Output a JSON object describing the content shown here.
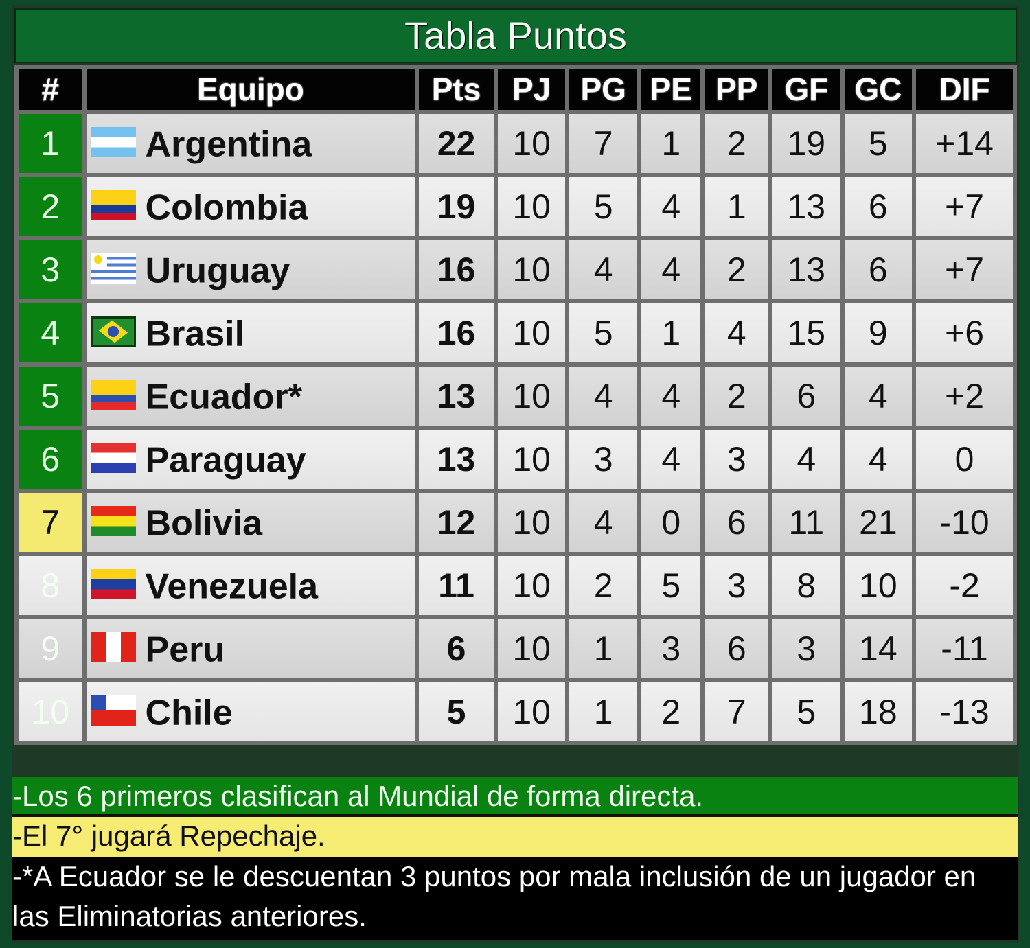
{
  "title": "Tabla Puntos",
  "columns": [
    "#",
    "Equipo",
    "Pts",
    "PJ",
    "PG",
    "PE",
    "PP",
    "GF",
    "GC",
    "DIF"
  ],
  "colors": {
    "direct_qualification": "#0a8212",
    "repechaje": "#f4ea72",
    "header_bg": "#030303",
    "title_bg": "#0b6a2c"
  },
  "rows": [
    {
      "pos": "1",
      "team": "Argentina",
      "flag": "argentina-flag",
      "status": "direct",
      "pts": "22",
      "pj": "10",
      "pg": "7",
      "pe": "1",
      "pp": "2",
      "gf": "19",
      "gc": "5",
      "dif": "+14"
    },
    {
      "pos": "2",
      "team": "Colombia",
      "flag": "colombia-flag",
      "status": "direct",
      "pts": "19",
      "pj": "10",
      "pg": "5",
      "pe": "4",
      "pp": "1",
      "gf": "13",
      "gc": "6",
      "dif": "+7"
    },
    {
      "pos": "3",
      "team": "Uruguay",
      "flag": "uruguay-flag",
      "status": "direct",
      "pts": "16",
      "pj": "10",
      "pg": "4",
      "pe": "4",
      "pp": "2",
      "gf": "13",
      "gc": "6",
      "dif": "+7"
    },
    {
      "pos": "4",
      "team": "Brasil",
      "flag": "brasil-flag",
      "status": "direct",
      "pts": "16",
      "pj": "10",
      "pg": "5",
      "pe": "1",
      "pp": "4",
      "gf": "15",
      "gc": "9",
      "dif": "+6"
    },
    {
      "pos": "5",
      "team": "Ecuador*",
      "flag": "ecuador-flag",
      "status": "direct",
      "pts": "13",
      "pj": "10",
      "pg": "4",
      "pe": "4",
      "pp": "2",
      "gf": "6",
      "gc": "4",
      "dif": "+2"
    },
    {
      "pos": "6",
      "team": "Paraguay",
      "flag": "paraguay-flag",
      "status": "direct",
      "pts": "13",
      "pj": "10",
      "pg": "3",
      "pe": "4",
      "pp": "3",
      "gf": "4",
      "gc": "4",
      "dif": "0"
    },
    {
      "pos": "7",
      "team": "Bolivia",
      "flag": "bolivia-flag",
      "status": "repechaje",
      "pts": "12",
      "pj": "10",
      "pg": "4",
      "pe": "0",
      "pp": "6",
      "gf": "11",
      "gc": "21",
      "dif": "-10"
    },
    {
      "pos": "8",
      "team": "Venezuela",
      "flag": "venezuela-flag",
      "status": "none",
      "pts": "11",
      "pj": "10",
      "pg": "2",
      "pe": "5",
      "pp": "3",
      "gf": "8",
      "gc": "10",
      "dif": "-2"
    },
    {
      "pos": "9",
      "team": "Peru",
      "flag": "peru-flag",
      "status": "none",
      "pts": "6",
      "pj": "10",
      "pg": "1",
      "pe": "3",
      "pp": "6",
      "gf": "3",
      "gc": "14",
      "dif": "-11"
    },
    {
      "pos": "10",
      "team": "Chile",
      "flag": "chile-flag",
      "status": "none",
      "pts": "5",
      "pj": "10",
      "pg": "1",
      "pe": "2",
      "pp": "7",
      "gf": "5",
      "gc": "18",
      "dif": "-13"
    }
  ],
  "notes": {
    "direct": "-Los 6 primeros clasifican al Mundial de forma directa.",
    "repechaje": "-El 7° jugará Repechaje.",
    "ecuador": "-*A Ecuador se le descuentan 3 puntos por mala inclusión de un jugador en las Eliminatorias anteriores."
  }
}
